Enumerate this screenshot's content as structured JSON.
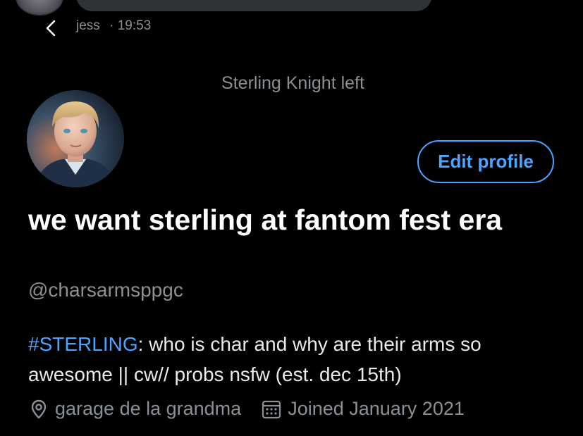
{
  "previous_message": {
    "sender": "jess",
    "separator": "·",
    "time": "19:53"
  },
  "system_message": "Sterling Knight left",
  "profile": {
    "display_name": "we want sterling at fantom fest era",
    "handle": "@charsarmsppgc",
    "edit_button": "Edit profile",
    "bio": {
      "hashtag": "#STERLING",
      "text": ": who is char and why are their arms so awesome || cw// probs nsfw (est. dec 15th)"
    },
    "location": "garage de la grandma",
    "joined": "Joined January 2021"
  },
  "icons": {
    "back": "chevron-left-icon",
    "location": "location-pin-icon",
    "joined": "calendar-icon"
  },
  "colors": {
    "background": "#000000",
    "accent": "#4da3ff",
    "secondary_text": "#8b9095",
    "primary_text": "#e7e9ea",
    "bubble": "#2f3336"
  }
}
